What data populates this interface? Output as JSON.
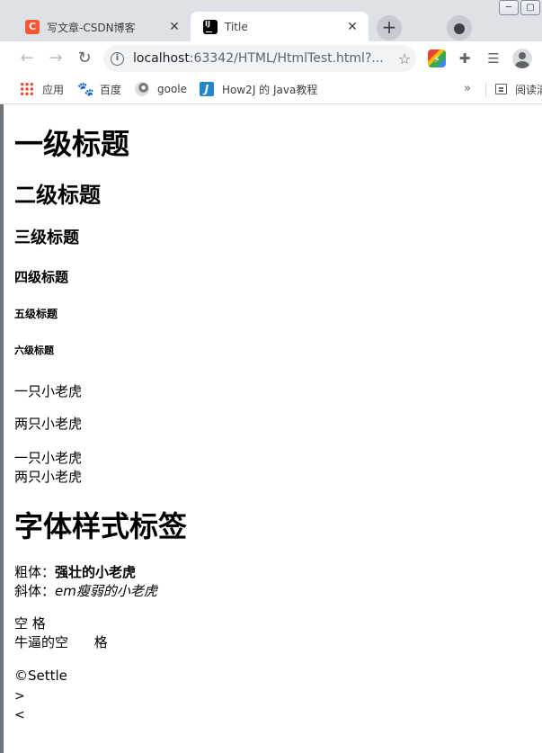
{
  "browser": {
    "window_controls": {
      "minimize": "─",
      "maximize": "▢"
    },
    "tabs": [
      {
        "title": "写文章-CSDN博客",
        "favicon": "csdn-icon",
        "favicon_text": "C",
        "active": false
      },
      {
        "title": "Title",
        "favicon": "intellij-icon",
        "favicon_text": "IJ",
        "active": true
      }
    ],
    "close_glyph": "✕",
    "new_tab_glyph": "+",
    "address": {
      "host": "localhost",
      "path": ":63342/HTML/HtmlTest.html?..."
    },
    "info_glyph": "i",
    "bookmarks": [
      {
        "label": "应用",
        "icon": "apps-icon"
      },
      {
        "label": "百度",
        "icon": "baidu-icon"
      },
      {
        "label": "goole",
        "icon": "goole-icon"
      },
      {
        "label": "How2J 的 Java教程",
        "icon": "how2j-icon"
      }
    ],
    "bookmarks_more": "»",
    "reading_list": "阅读清"
  },
  "page": {
    "h1": "一级标题",
    "h2": "二级标题",
    "h3": "三级标题",
    "h4": "四级标题",
    "h5": "五级标题",
    "h6": "六级标题",
    "para1": "一只小老虎",
    "para2": "两只小老虎",
    "para3_line1": "一只小老虎",
    "para3_line2": "两只小老虎",
    "font_heading": "字体样式标签",
    "bold_label": "粗体：",
    "bold_text": "强壮的小老虎",
    "italic_label": "斜体：",
    "italic_text": "em瘦弱的小老虎",
    "space_line1": "空 格",
    "space_line2": "牛逼的空      格",
    "copyright": "©Settle",
    "gt": ">",
    "lt": "<"
  }
}
